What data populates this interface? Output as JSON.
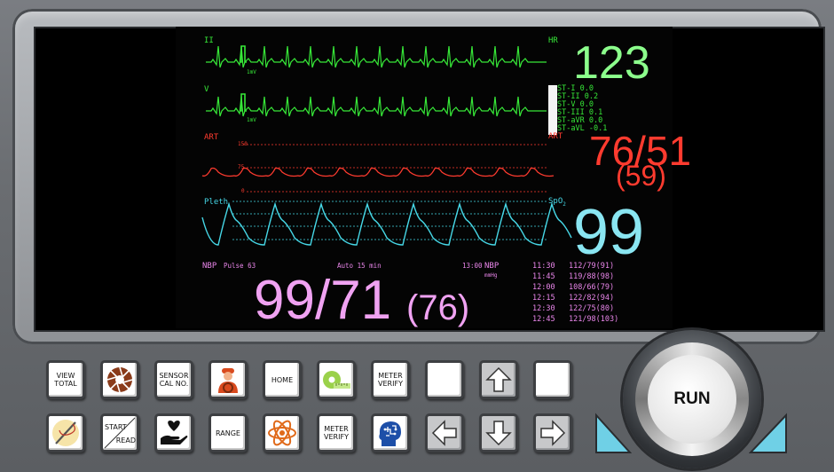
{
  "waves": {
    "ecg1": {
      "label": "II",
      "scale": "1mV"
    },
    "ecg2": {
      "label": "V",
      "scale": "1mV"
    },
    "art": {
      "label": "ART",
      "grid": [
        "150",
        "75",
        "0"
      ]
    },
    "pleth": {
      "label": "Pleth"
    }
  },
  "vitals": {
    "hr": {
      "label": "HR",
      "value": "123"
    },
    "art": {
      "label": "ART",
      "value": "76/51",
      "mean": "(59)"
    },
    "spo2": {
      "label": "SpO",
      "sub": "2",
      "value": "99"
    }
  },
  "st": [
    {
      "name": "ST-I",
      "value": "0.0"
    },
    {
      "name": "ST-II",
      "value": "0.2"
    },
    {
      "name": "ST-V",
      "value": "0.0"
    },
    {
      "name": "ST-III",
      "value": "0.1"
    },
    {
      "name": "ST-aVR",
      "value": "0.0"
    },
    {
      "name": "ST-aVL",
      "value": "-0.1"
    }
  ],
  "nbp": {
    "label": "NBP",
    "pulse": "Pulse 63",
    "mode": "Auto 15 min",
    "time": "13:00",
    "value": "99/71",
    "mean": "(76)",
    "trend_label": "NBP",
    "unit": "mmHg"
  },
  "nbp_trend": [
    {
      "time": "11:30",
      "value": "112/79(91)"
    },
    {
      "time": "11:45",
      "value": "119/88(98)"
    },
    {
      "time": "12:00",
      "value": "108/66(79)"
    },
    {
      "time": "12:15",
      "value": "122/82(94)"
    },
    {
      "time": "12:30",
      "value": "122/75(80)"
    },
    {
      "time": "12:45",
      "value": "121/98(103)"
    }
  ],
  "buttons": {
    "view_total": "VIEW TOTAL",
    "sensor_cal": "SENSOR CAL NO.",
    "home": "HOME",
    "meter_verify_1": "METER VERIFY",
    "start": "START",
    "read": "READ",
    "range": "RANGE",
    "meter_verify_2": "METER VERIFY",
    "run": "RUN"
  },
  "icons": {
    "aperture": "camera-aperture-icon",
    "worker": "worker-icon",
    "tape": "tape-measure-icon",
    "needle": "needle-thread-icon",
    "heart_hand": "heart-hand-icon",
    "atom": "atom-icon",
    "brain": "brain-head-icon",
    "up": "arrow-up-icon",
    "down": "arrow-down-icon",
    "left": "arrow-left-icon",
    "right": "arrow-right-icon"
  },
  "colors": {
    "ecg": "#37e838",
    "art": "#ff3b2f",
    "pleth": "#46d7e6",
    "nbp": "#e986ea",
    "hr_number": "#8cff8c",
    "art_number": "#ff3b2f",
    "spo2_number": "#8ae6f2",
    "nbp_number": "#f0a2f2"
  }
}
